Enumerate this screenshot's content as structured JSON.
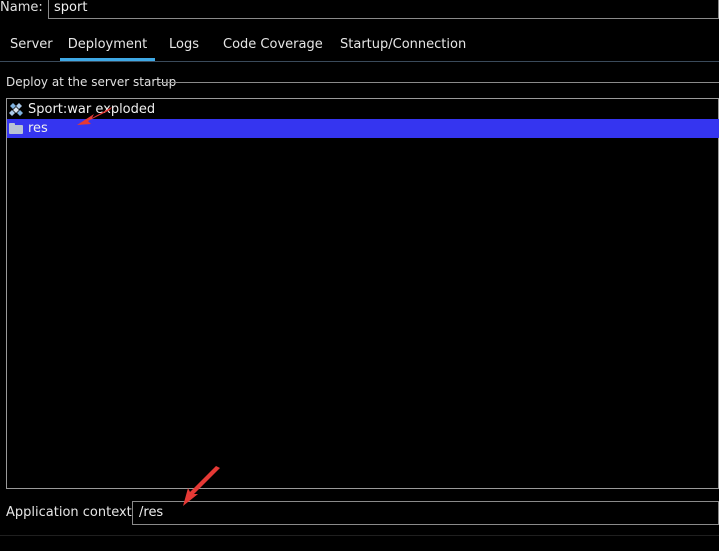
{
  "name_field": {
    "label": "Name:",
    "value": "sport"
  },
  "tabs": [
    {
      "label": "Server"
    },
    {
      "label": "Deployment",
      "active": true
    },
    {
      "label": "Logs"
    },
    {
      "label": "Code Coverage"
    },
    {
      "label": "Startup/Connection"
    }
  ],
  "deploy_section": {
    "title": "Deploy at the server startup",
    "items": [
      {
        "label": "Sport:war exploded",
        "icon": "artifact-icon"
      },
      {
        "label": "res",
        "icon": "folder-icon",
        "selected": true
      }
    ]
  },
  "app_context": {
    "label": "Application context:",
    "value": "/res"
  },
  "colors": {
    "background": "#000000",
    "selection": "#3535f0",
    "tab_underline": "#3fa9e6",
    "annotation_arrow": "#e53935"
  },
  "annotations": [
    {
      "icon": "red-arrow-annotation"
    },
    {
      "icon": "red-arrow-annotation"
    }
  ]
}
